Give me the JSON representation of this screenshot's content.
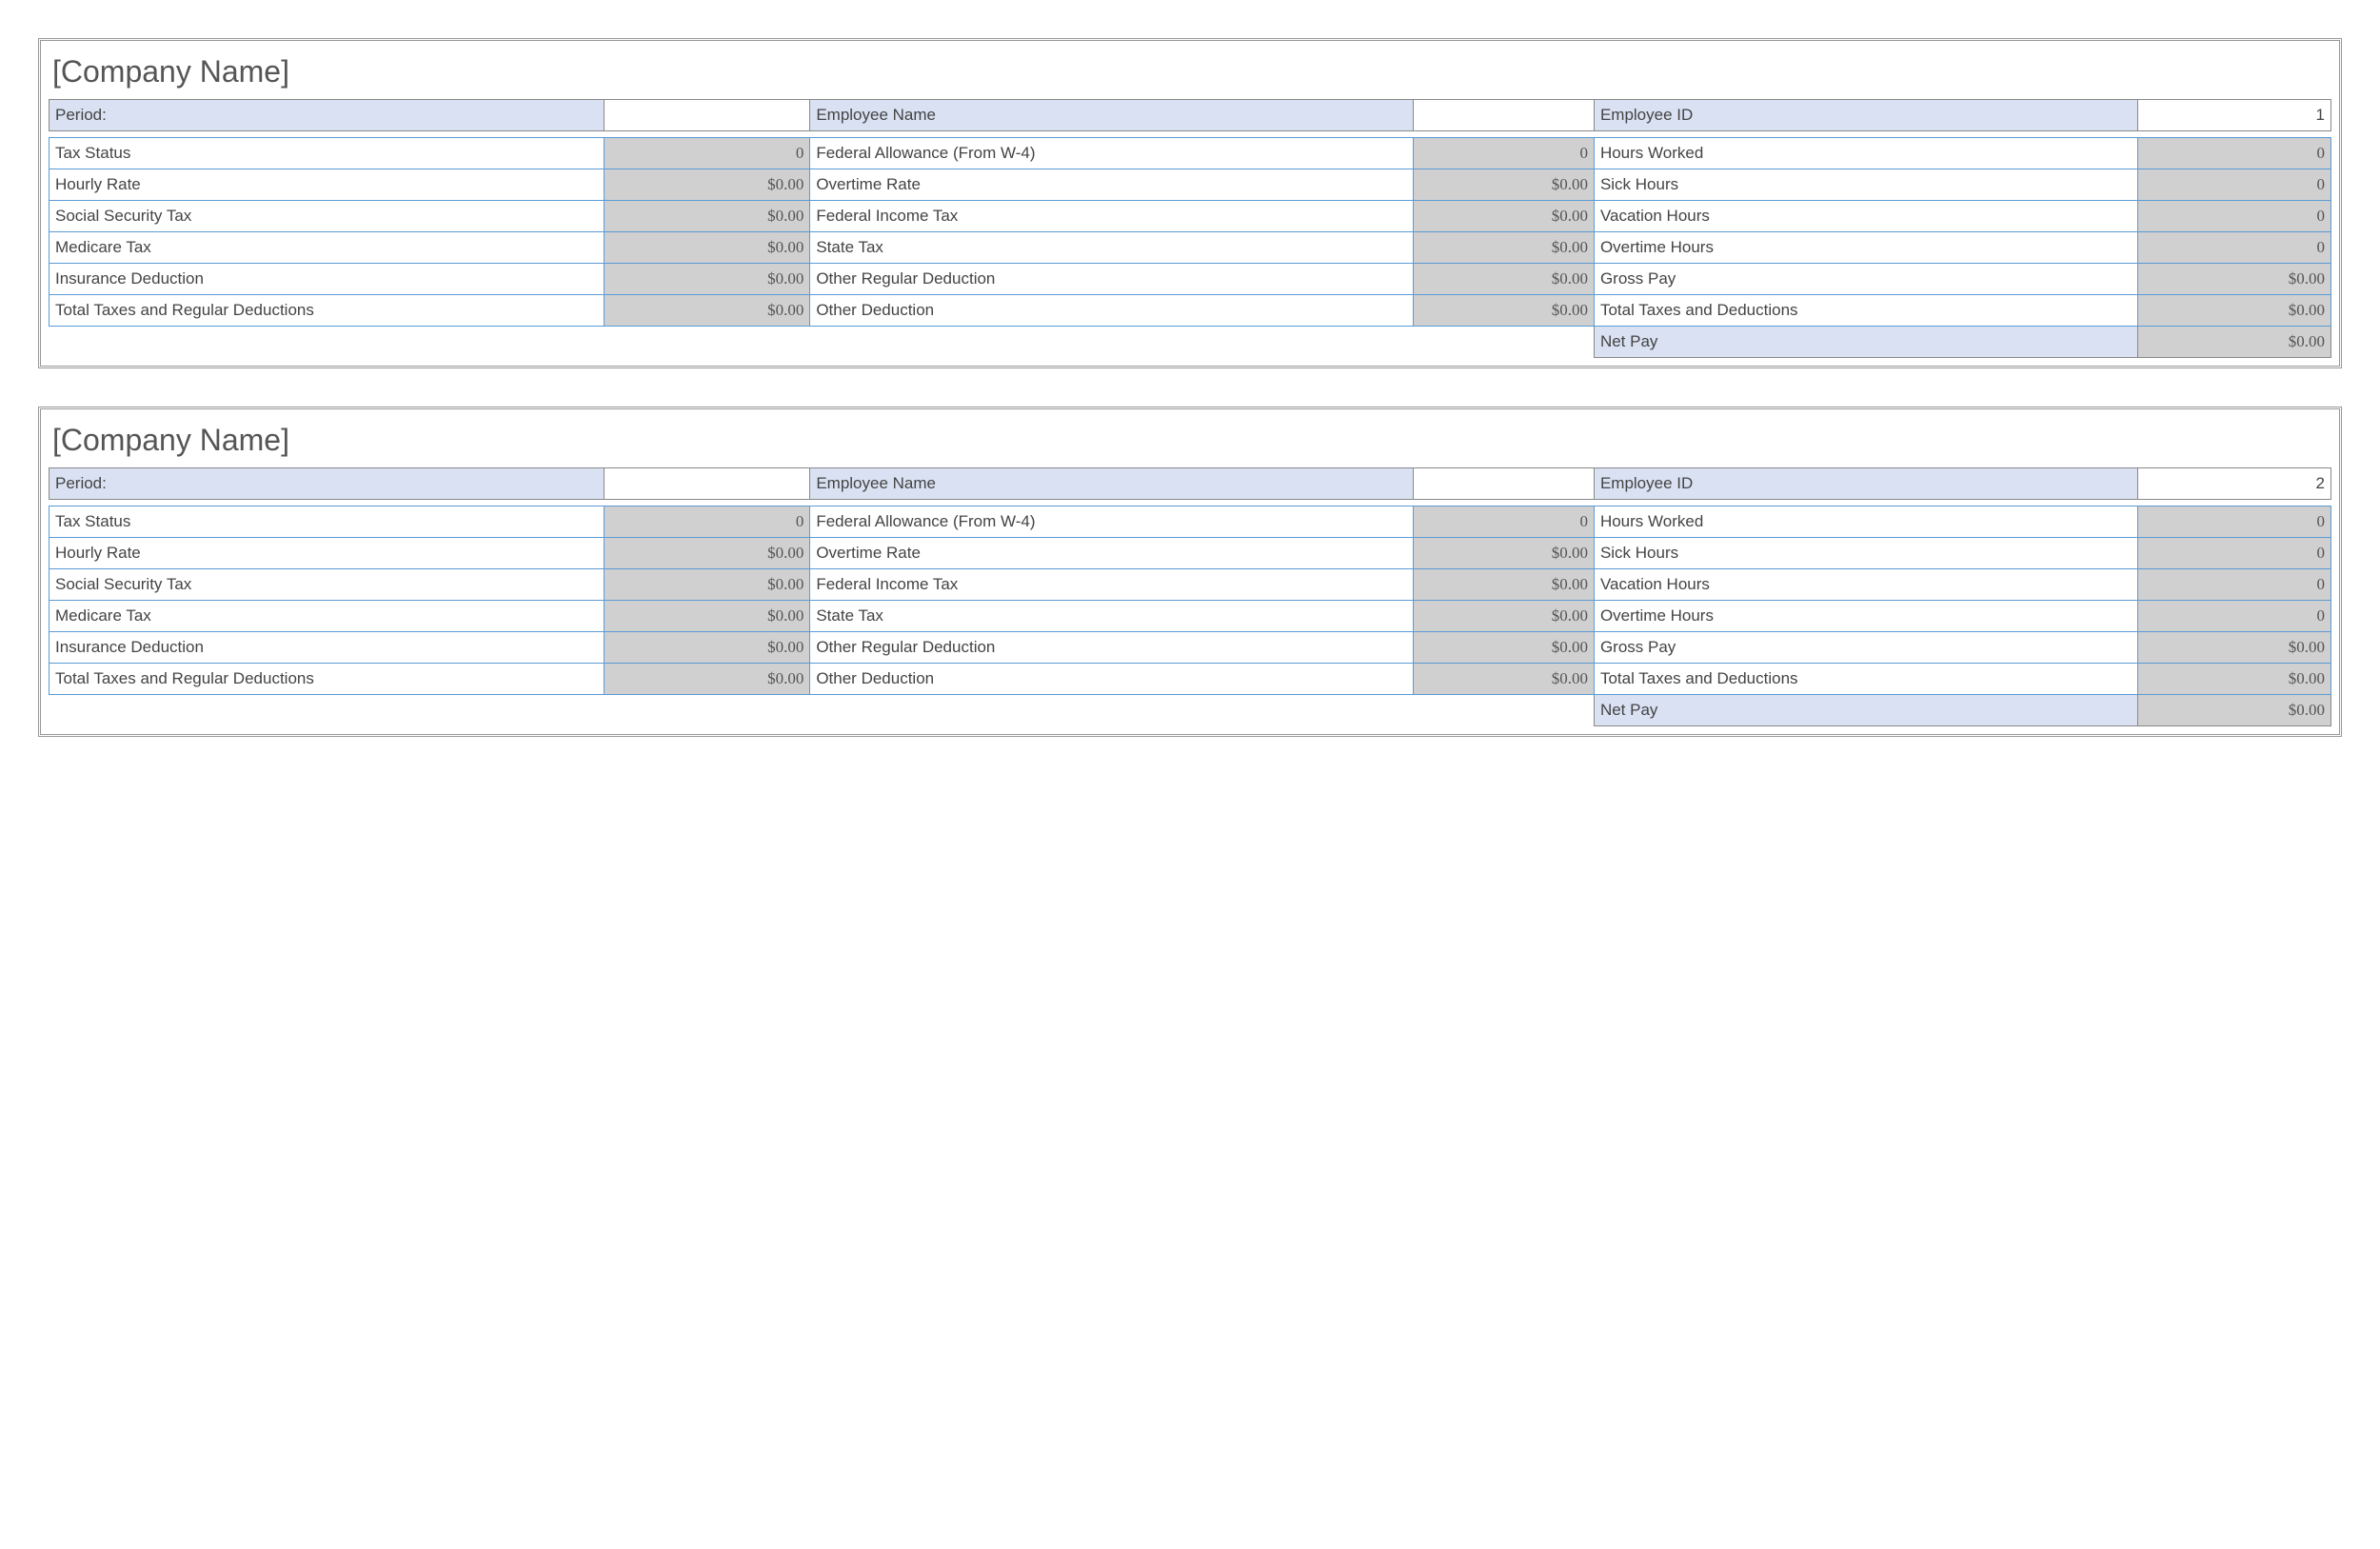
{
  "stubs": [
    {
      "company_name": "[Company Name]",
      "header": {
        "period_label": "Period:",
        "period_value": "",
        "emp_name_label": "Employee Name",
        "emp_name_value": "",
        "emp_id_label": "Employee ID",
        "emp_id_value": "1"
      },
      "rows": [
        {
          "l1": "Tax Status",
          "v1": "0",
          "l2": "Federal Allowance (From W-4)",
          "v2": "0",
          "l3": "Hours Worked",
          "v3": "0"
        },
        {
          "l1": "Hourly Rate",
          "v1": "$0.00",
          "l2": "Overtime Rate",
          "v2": "$0.00",
          "l3": "Sick Hours",
          "v3": "0"
        },
        {
          "l1": "Social Security Tax",
          "v1": "$0.00",
          "l2": "Federal Income Tax",
          "v2": "$0.00",
          "l3": "Vacation Hours",
          "v3": "0"
        },
        {
          "l1": "Medicare Tax",
          "v1": "$0.00",
          "l2": "State Tax",
          "v2": "$0.00",
          "l3": "Overtime Hours",
          "v3": "0"
        },
        {
          "l1": "Insurance Deduction",
          "v1": "$0.00",
          "l2": "Other Regular Deduction",
          "v2": "$0.00",
          "l3": "Gross Pay",
          "v3": "$0.00"
        },
        {
          "l1": "Total Taxes and Regular Deductions",
          "v1": "$0.00",
          "l2": "Other Deduction",
          "v2": "$0.00",
          "l3": "Total Taxes and Deductions",
          "v3": "$0.00"
        }
      ],
      "net": {
        "label": "Net Pay",
        "value": "$0.00"
      }
    },
    {
      "company_name": "[Company Name]",
      "header": {
        "period_label": "Period:",
        "period_value": "",
        "emp_name_label": "Employee Name",
        "emp_name_value": "",
        "emp_id_label": "Employee ID",
        "emp_id_value": "2"
      },
      "rows": [
        {
          "l1": "Tax Status",
          "v1": "0",
          "l2": "Federal Allowance (From W-4)",
          "v2": "0",
          "l3": "Hours Worked",
          "v3": "0"
        },
        {
          "l1": "Hourly Rate",
          "v1": "$0.00",
          "l2": "Overtime Rate",
          "v2": "$0.00",
          "l3": "Sick Hours",
          "v3": "0"
        },
        {
          "l1": "Social Security Tax",
          "v1": "$0.00",
          "l2": "Federal Income Tax",
          "v2": "$0.00",
          "l3": "Vacation Hours",
          "v3": "0"
        },
        {
          "l1": "Medicare Tax",
          "v1": "$0.00",
          "l2": "State Tax",
          "v2": "$0.00",
          "l3": "Overtime Hours",
          "v3": "0"
        },
        {
          "l1": "Insurance Deduction",
          "v1": "$0.00",
          "l2": "Other Regular Deduction",
          "v2": "$0.00",
          "l3": "Gross Pay",
          "v3": "$0.00"
        },
        {
          "l1": "Total Taxes and Regular Deductions",
          "v1": "$0.00",
          "l2": "Other Deduction",
          "v2": "$0.00",
          "l3": "Total Taxes and Deductions",
          "v3": "$0.00"
        }
      ],
      "net": {
        "label": "Net Pay",
        "value": "$0.00"
      }
    }
  ]
}
